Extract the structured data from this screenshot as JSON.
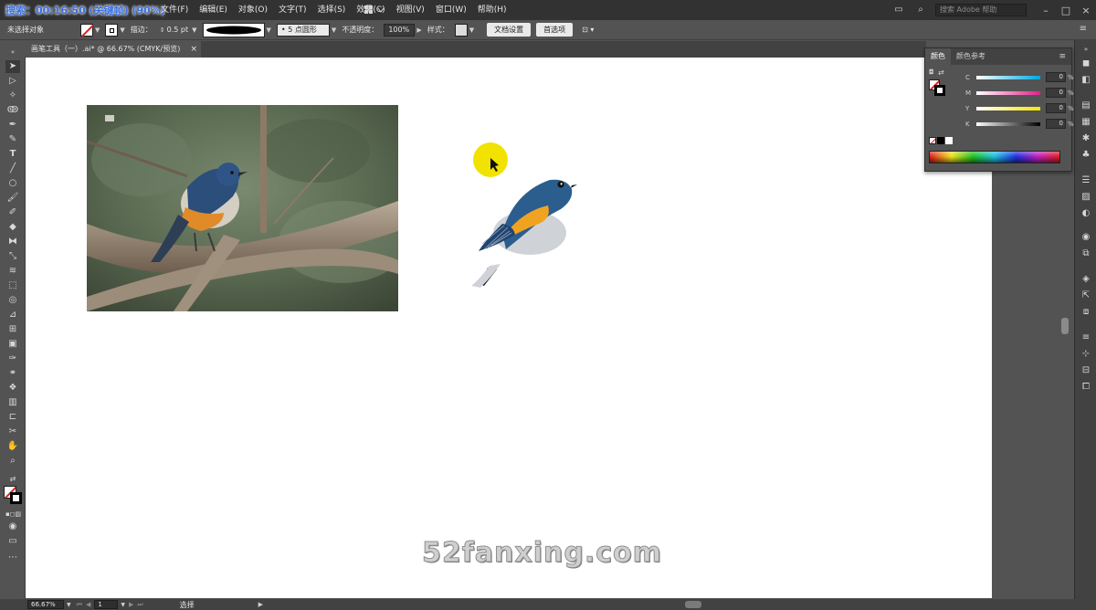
{
  "recording_overlay": "搜索：00:16:50 (关键帧) (90%)",
  "menu": {
    "items": [
      "文件(F)",
      "编辑(E)",
      "对象(O)",
      "文字(T)",
      "选择(S)",
      "效果(C)",
      "视图(V)",
      "窗口(W)",
      "帮助(H)"
    ],
    "search_placeholder": "搜索 Adobe 帮助"
  },
  "control_bar": {
    "selection_status": "未选择对象",
    "stroke_label": "描边：",
    "stroke_value": "0.5 pt",
    "brush_label": "5 点圆形",
    "opacity_label": "不透明度：",
    "opacity_value": "100%",
    "style_label": "样式：",
    "doc_setup_button": "文档设置",
    "preferences_button": "首选项"
  },
  "document_tab": {
    "title": "画笔工具（一）.ai* @ 66.67% (CMYK/预览)",
    "close": "×"
  },
  "color_panel": {
    "tabs": [
      "颜色",
      "颜色参考"
    ],
    "channels": [
      {
        "letter": "C",
        "value": "0",
        "unit": "%"
      },
      {
        "letter": "M",
        "value": "0",
        "unit": "%"
      },
      {
        "letter": "Y",
        "value": "0",
        "unit": "%"
      },
      {
        "letter": "K",
        "value": "0",
        "unit": "%"
      }
    ]
  },
  "status_bar": {
    "zoom": "66.67%",
    "page": "1",
    "tool": "选择"
  },
  "watermark": "52fanxing.com",
  "colors": {
    "bird_blue": "#2b5e8e",
    "bird_orange": "#f0a321",
    "bird_belly": "#cfd3d8",
    "cursor_highlight": "#f2e200"
  }
}
